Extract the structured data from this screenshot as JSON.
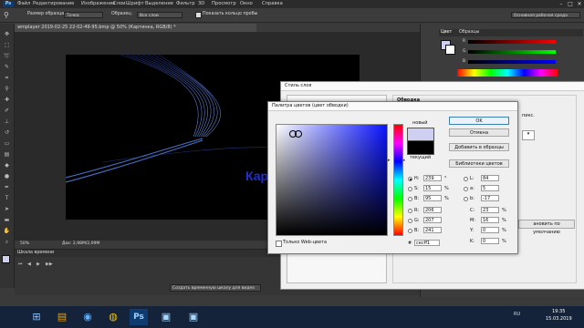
{
  "app": {
    "logo": "Ps"
  },
  "menu": [
    "Файл",
    "Редактирование",
    "Изображение",
    "Слои",
    "Шрифт",
    "Выделение",
    "Фильтр",
    "3D",
    "Просмотр",
    "Окно",
    "Справка"
  ],
  "window_controls": [
    "–",
    "□",
    "✕"
  ],
  "options_bar": {
    "size_label": "Размер образца:",
    "size_value": "Точка",
    "sample_label": "Образец:",
    "sample_value": "Все слои",
    "show_ring_label": "Показать кольцо пробы",
    "workspace_value": "Основная рабочая среда"
  },
  "document": {
    "tab_title": "wmplayer 2019-02-25 22-02-49-95.bmp @ 50% (Картинка, RGB/8) *",
    "zoom": "50%",
    "doc_size": "Док: 2,98M/2,09M",
    "canvas_text": "Кар"
  },
  "timeline": {
    "title": "Шкала времени",
    "create_button": "Создать временную шкалу для видео"
  },
  "right_panel": {
    "tab_color": "Цвет",
    "tab_swatches": "Образцы",
    "sliders": [
      {
        "label": "R",
        "value": ""
      },
      {
        "label": "G",
        "value": ""
      },
      {
        "label": "B",
        "value": ""
      }
    ]
  },
  "layer_style": {
    "title": "Стиль слоя",
    "section": "Обводка",
    "fragment_right": "пикс.",
    "default_button": "ановить по умолчанию"
  },
  "color_picker": {
    "title": "Палитра цветов (цвет обводки)",
    "new_label": "новый",
    "current_label": "текущий",
    "ok": "OK",
    "cancel": "Отмена",
    "add_swatch": "Добавить в образцы",
    "libraries": "Библиотеки цветов",
    "web_only": "Только Web-цвета",
    "hex_label": "#",
    "hex": "cecff1",
    "new_color": "#cecff1",
    "current_color": "#000000",
    "hsb": [
      {
        "label": "H:",
        "value": "239",
        "unit": "°"
      },
      {
        "label": "S:",
        "value": "15",
        "unit": "%"
      },
      {
        "label": "B:",
        "value": "95",
        "unit": "%"
      }
    ],
    "rgb": [
      {
        "label": "R:",
        "value": "206"
      },
      {
        "label": "G:",
        "value": "207"
      },
      {
        "label": "B:",
        "value": "241"
      }
    ],
    "lab": [
      {
        "label": "L:",
        "value": "84"
      },
      {
        "label": "a:",
        "value": "5"
      },
      {
        "label": "b:",
        "value": "-17"
      }
    ],
    "cmyk": [
      {
        "label": "C:",
        "value": "23",
        "unit": "%"
      },
      {
        "label": "M:",
        "value": "16",
        "unit": "%"
      },
      {
        "label": "Y:",
        "value": "0",
        "unit": "%"
      },
      {
        "label": "K:",
        "value": "0",
        "unit": "%"
      }
    ]
  },
  "taskbar": {
    "lang": "RU",
    "time": "19:35",
    "date": "15.03.2019"
  }
}
